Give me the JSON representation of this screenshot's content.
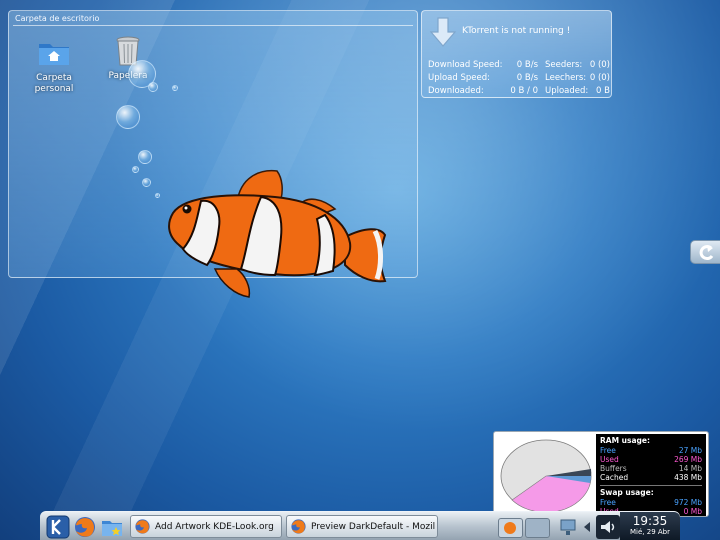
{
  "folder_view": {
    "title": "Carpeta de escritorio",
    "icons": [
      {
        "label_line1": "Carpeta",
        "label_line2": "personal",
        "icon": "home-folder-icon"
      },
      {
        "label_line1": "Papelera",
        "label_line2": "",
        "icon": "trash-icon"
      }
    ]
  },
  "ktorrent": {
    "status": "KTorrent is not running !",
    "rows": [
      {
        "k1": "Download Speed:",
        "v1": "0 B/s",
        "k2": "Seeders:",
        "v2": "0 (0)"
      },
      {
        "k1": "Upload Speed:",
        "v1": "0 B/s",
        "k2": "Leechers:",
        "v2": "0 (0)"
      },
      {
        "k1": "Downloaded:",
        "v1": "0 B / 0",
        "k2": "Uploaded:",
        "v2": "0 B"
      }
    ]
  },
  "system_monitor": {
    "ram": {
      "title": "RAM usage:",
      "rows": [
        {
          "label": "Free",
          "value": "27 Mb",
          "color": "#4aa3ff"
        },
        {
          "label": "Used",
          "value": "269 Mb",
          "color": "#ff5ad2"
        },
        {
          "label": "Buffers",
          "value": "14 Mb",
          "color": "#bdbdbd"
        },
        {
          "label": "Cached",
          "value": "438 Mb",
          "color": "#ffffff"
        }
      ]
    },
    "swap": {
      "title": "Swap usage:",
      "rows": [
        {
          "label": "Free",
          "value": "972 Mb",
          "color": "#4aa3ff"
        },
        {
          "label": "Used",
          "value": "0 Mb",
          "color": "#ff5ad2"
        }
      ]
    },
    "pie_colors": {
      "cached": "#e2e2e2",
      "used": "#f59ae8",
      "free": "#5f9ad6",
      "buffers": "#3a4656"
    }
  },
  "taskbar": {
    "tasks": [
      {
        "label": "Add Artwork KDE-Look.org",
        "icon": "firefox-icon"
      },
      {
        "label": "Preview DarkDefault - Mozil",
        "icon": "firefox-icon"
      }
    ],
    "clock": {
      "time": "19:35",
      "date": "Mié, 29 Abr"
    }
  },
  "colors": {
    "accent": "#2f7cc4",
    "fish_orange": "#ef6a12"
  }
}
